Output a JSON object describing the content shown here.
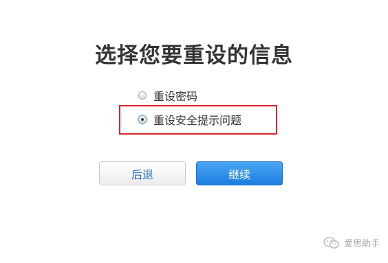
{
  "page": {
    "title": "选择您要重设的信息"
  },
  "options": [
    {
      "label": "重设密码",
      "checked": false
    },
    {
      "label": "重设安全提示问题",
      "checked": true
    }
  ],
  "buttons": {
    "back_label": "后退",
    "continue_label": "继续"
  },
  "watermark": {
    "text": "爱思助手",
    "icon": "wechat-icon"
  },
  "colors": {
    "highlight_border": "#d9242a",
    "primary_button": "#1e7ee0",
    "back_button_text": "#1a6dc4"
  }
}
